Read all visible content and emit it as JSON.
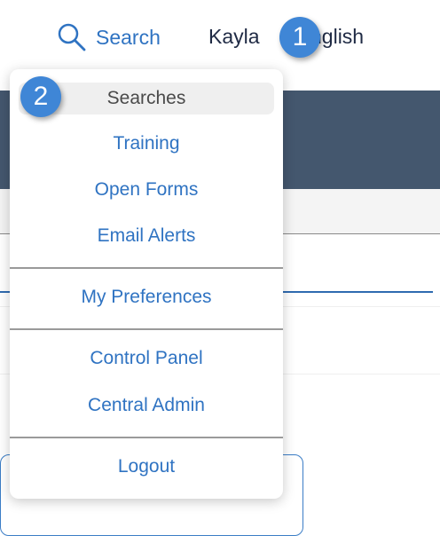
{
  "header": {
    "search_label": "Search",
    "search_icon": "search-icon",
    "user_name": "Kayla",
    "language_text": "nglish"
  },
  "dropdown": {
    "items": [
      {
        "label": "Searches",
        "selected": true
      },
      {
        "label": "Training"
      },
      {
        "label": "Open Forms"
      },
      {
        "label": "Email Alerts"
      },
      {
        "label": "My Preferences"
      },
      {
        "label": "Control Panel"
      },
      {
        "label": "Central Admin"
      },
      {
        "label": "Logout"
      }
    ]
  },
  "callouts": [
    "1",
    "2"
  ],
  "colors": {
    "link_blue": "#2f73c2",
    "header_band": "#44576e",
    "callout_blue": "#3f86d6"
  }
}
